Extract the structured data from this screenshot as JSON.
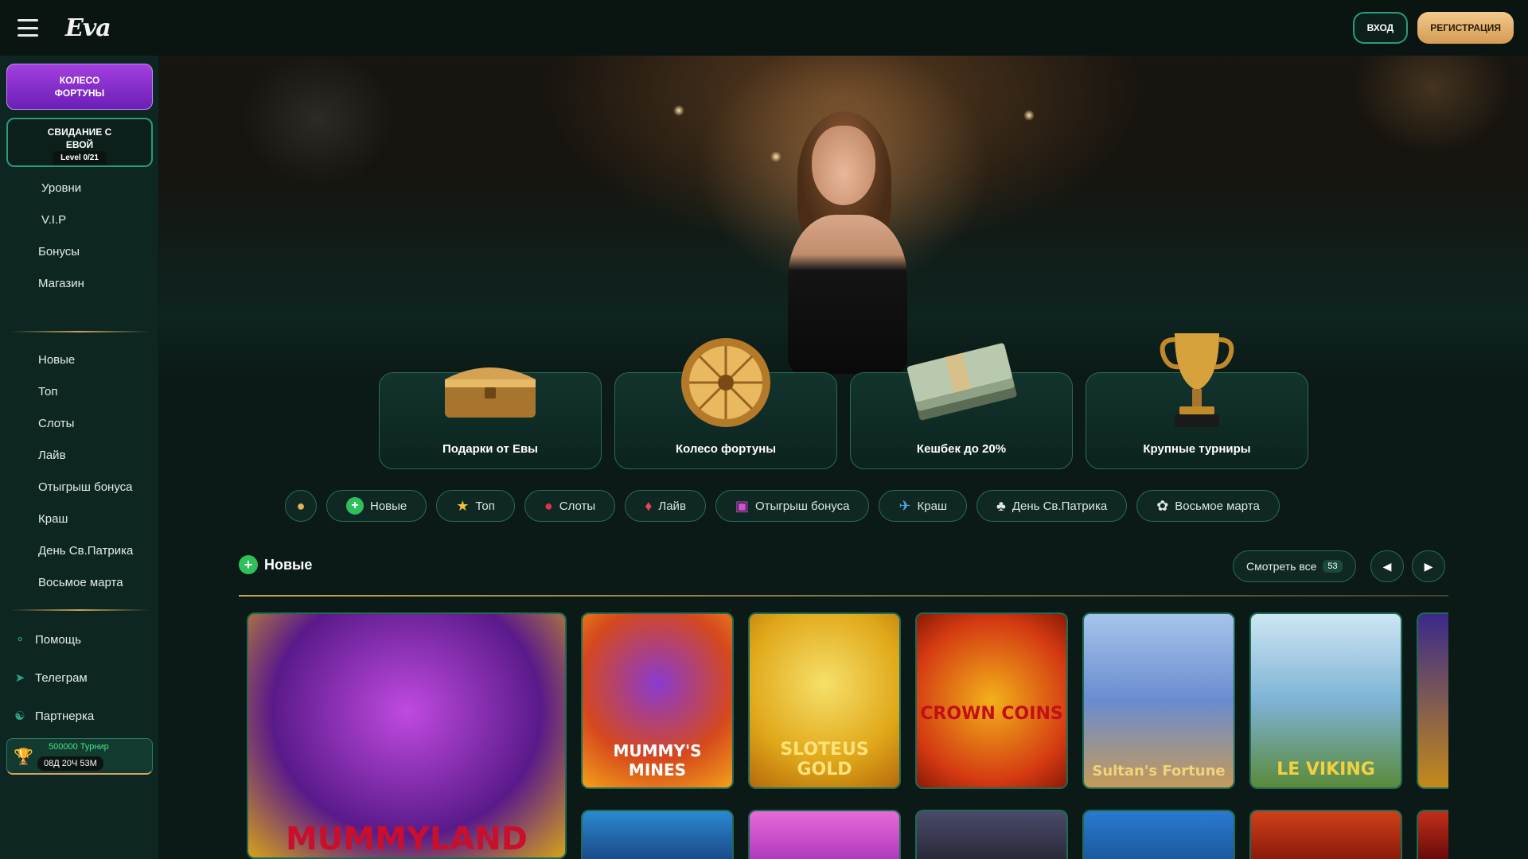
{
  "header": {
    "logo": "Eva",
    "login_label": "ВХОД",
    "register_label": "РЕГИСТРАЦИЯ"
  },
  "sidebar": {
    "wheel_card": "КОЛЕСО ФОРТУНЫ",
    "date_card": {
      "title": "СВИДАНИЕ С ЕВОЙ",
      "level": "Level 0/21"
    },
    "top_items": [
      "Уровни",
      "V.I.P",
      "Бонусы",
      "Магазин"
    ],
    "categories": [
      "Новые",
      "Топ",
      "Слоты",
      "Лайв",
      "Отыгрыш бонуса",
      "Краш",
      "День Св.Патрика",
      "Восьмое марта"
    ],
    "bottom_items": [
      {
        "label": "Помощь",
        "icon": "headset-icon"
      },
      {
        "label": "Телеграм",
        "icon": "telegram-icon"
      },
      {
        "label": "Партнерка",
        "icon": "partner-icon"
      }
    ],
    "tournament": {
      "name": "500000 Турнир",
      "time": "08Д 20Ч 53М"
    }
  },
  "promos": [
    {
      "label": "Подарки от Евы",
      "icon": "gift-chest-icon"
    },
    {
      "label": "Колесо фортуны",
      "icon": "fortune-wheel-icon"
    },
    {
      "label": "Кешбек до 20%",
      "icon": "cash-stack-icon"
    },
    {
      "label": "Крупные турниры",
      "icon": "trophy-icon"
    }
  ],
  "chips": [
    {
      "label": "",
      "icon": "coin-icon"
    },
    {
      "label": "Новые",
      "icon": "plus-icon"
    },
    {
      "label": "Топ",
      "icon": "star-icon"
    },
    {
      "label": "Слоты",
      "icon": "cherry-icon"
    },
    {
      "label": "Лайв",
      "icon": "chip-icon"
    },
    {
      "label": "Отыгрыш бонуса",
      "icon": "gift-icon"
    },
    {
      "label": "Краш",
      "icon": "plane-icon"
    },
    {
      "label": "День Св.Патрика",
      "icon": "clover-icon"
    },
    {
      "label": "Восьмое марта",
      "icon": "flower-icon"
    }
  ],
  "section": {
    "title": "Новые",
    "see_all": "Смотреть все",
    "count": "53"
  },
  "games": [
    {
      "title": "MUMMYLAND",
      "color": "#7a2fb8"
    },
    {
      "title": "MUMMY'S MINES",
      "color": "#d6491c"
    },
    {
      "title": "SLOTEUS GOLD",
      "color": "#e0a81a"
    },
    {
      "title": "CROWN COINS",
      "color": "#d43a12"
    },
    {
      "title": "Sultan's Fortune",
      "color": "#6a8ccf"
    },
    {
      "title": "LE VIKING",
      "color": "#7eb3d6"
    }
  ]
}
